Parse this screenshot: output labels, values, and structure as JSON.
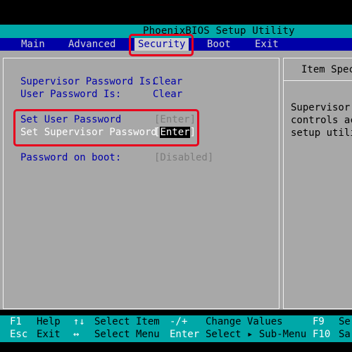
{
  "title": "PhoenixBIOS Setup Utility",
  "menu": [
    "Main",
    "Advanced",
    "Security",
    "Boot",
    "Exit"
  ],
  "active_menu": "Security",
  "settings": {
    "supervisor_password_is": {
      "label": "Supervisor Password Is:",
      "value": "Clear"
    },
    "user_password_is": {
      "label": "User Password Is:",
      "value": "Clear"
    },
    "set_user_password": {
      "label": "Set User Password",
      "value": "[Enter]"
    },
    "set_supervisor_password": {
      "label": "Set Supervisor Password",
      "value_left": "[",
      "value_mid": "Enter",
      "value_right": "]"
    },
    "password_on_boot": {
      "label": "Password on boot:",
      "value": "[Disabled]"
    }
  },
  "help_panel": {
    "title": "Item Speci",
    "lines": [
      "Supervisor P",
      "controls acc",
      "setup utilit"
    ]
  },
  "status": {
    "row1": [
      {
        "key": "F1",
        "text": "Help"
      },
      {
        "key": "↑↓",
        "text": "Select Item"
      },
      {
        "key": "-/+",
        "text": "Change Values"
      },
      {
        "key": "F9",
        "text": "Se"
      }
    ],
    "row2": [
      {
        "key": "Esc",
        "text": "Exit"
      },
      {
        "key": "↔",
        "text": "Select Menu"
      },
      {
        "key": "Enter",
        "text": "Select ▸ Sub-Menu"
      },
      {
        "key": "F10",
        "text": "Sa"
      }
    ]
  },
  "colors": {
    "title_bg": "#00a8a8",
    "menu_bg": "#0000a8",
    "panel_bg": "#a8a8a8",
    "annotation": "#e8001c"
  }
}
